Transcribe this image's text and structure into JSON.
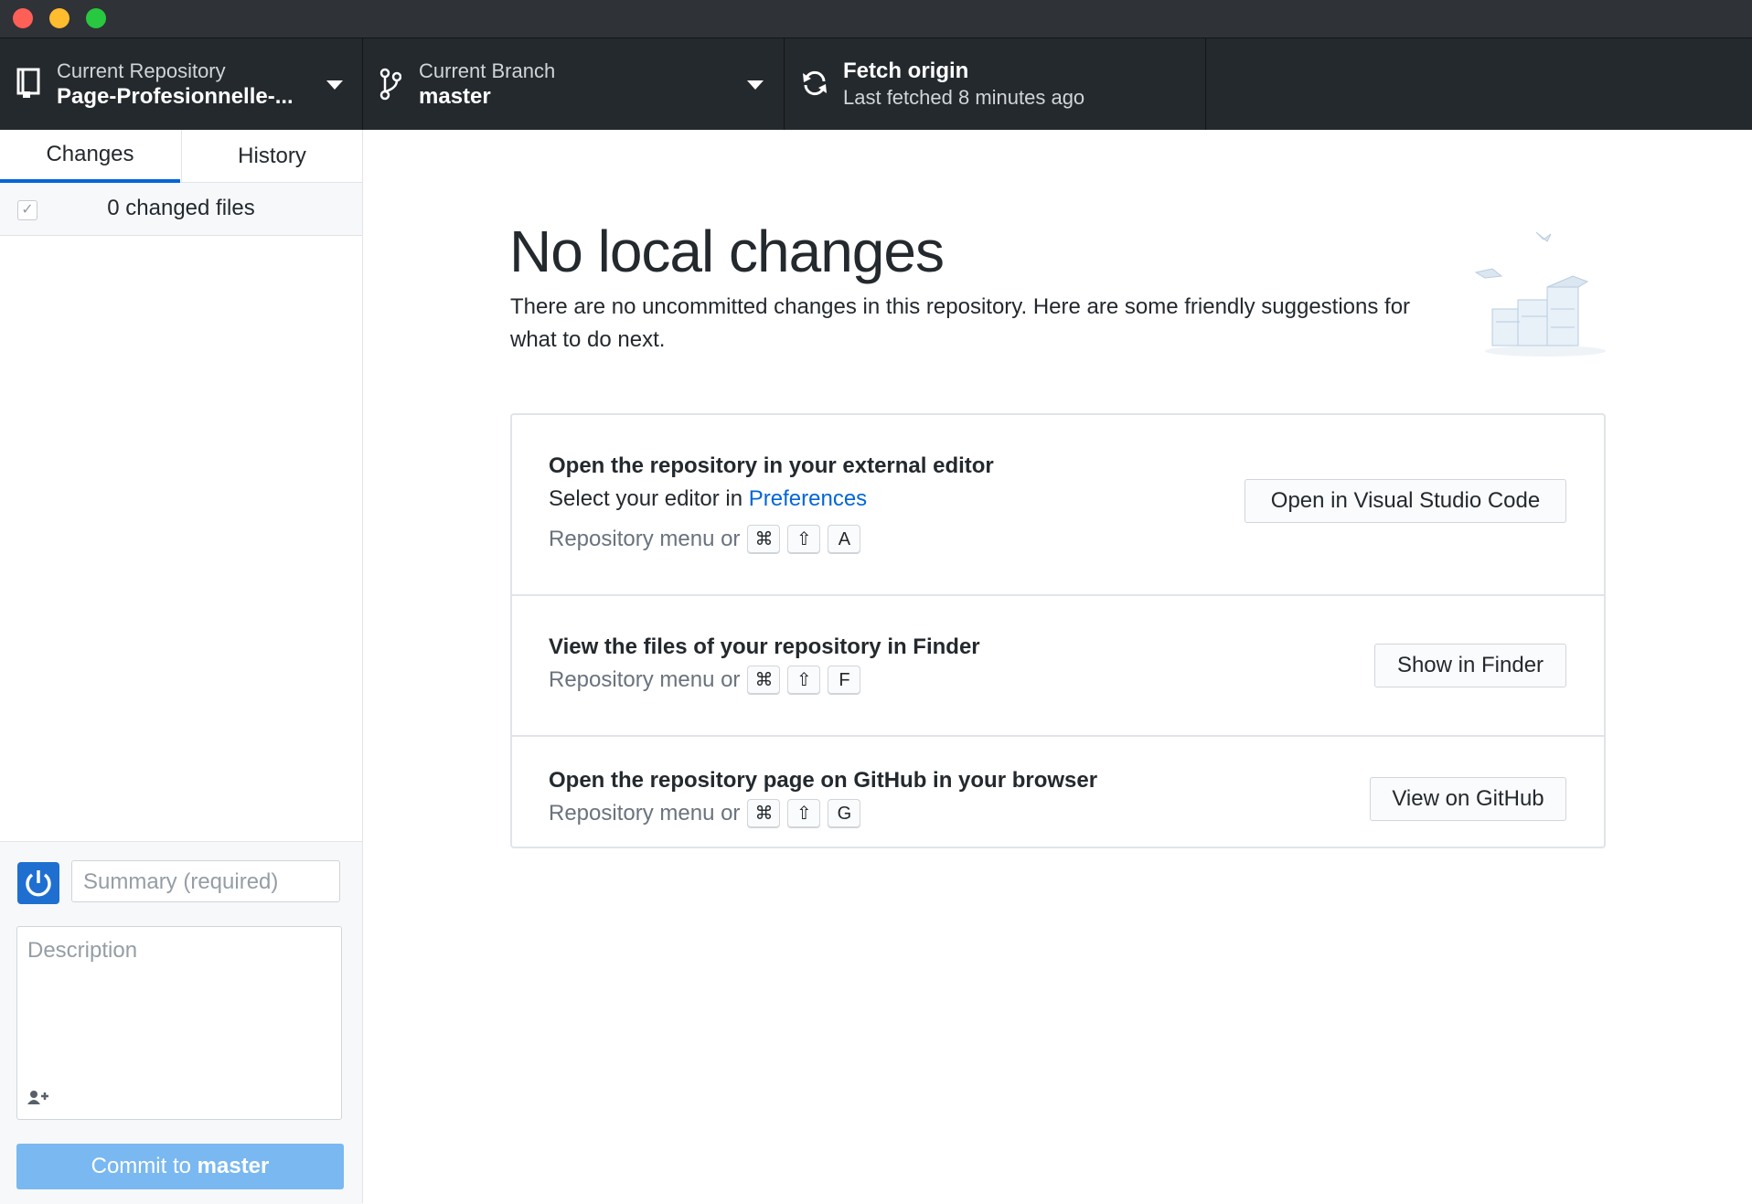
{
  "window": {
    "traffic_lights": [
      "close",
      "minimize",
      "maximize"
    ]
  },
  "toolbar": {
    "repository": {
      "label": "Current Repository",
      "value": "Page-Profesionnelle-..."
    },
    "branch": {
      "label": "Current Branch",
      "value": "master"
    },
    "fetch": {
      "title": "Fetch origin",
      "subtitle": "Last fetched 8 minutes ago"
    }
  },
  "sidebar": {
    "tabs": [
      {
        "label": "Changes",
        "active": true
      },
      {
        "label": "History",
        "active": false
      }
    ],
    "changed_files": "0 changed files",
    "commit": {
      "summary_placeholder": "Summary (required)",
      "description_placeholder": "Description",
      "button_prefix": "Commit to",
      "button_branch": "master"
    }
  },
  "main": {
    "heading": "No local changes",
    "intro": "There are no uncommitted changes in this repository. Here are some friendly suggestions for what to do next.",
    "suggestions": [
      {
        "title": "Open the repository in your external editor",
        "subtitle_prefix": "Select your editor in",
        "subtitle_link": "Preferences",
        "shortcut_prefix": "Repository menu or",
        "keys": [
          "⌘",
          "⇧",
          "A"
        ],
        "button": "Open in Visual Studio Code"
      },
      {
        "title": "View the files of your repository in Finder",
        "shortcut_prefix": "Repository menu or",
        "keys": [
          "⌘",
          "⇧",
          "F"
        ],
        "button": "Show in Finder"
      },
      {
        "title": "Open the repository page on GitHub in your browser",
        "shortcut_prefix": "Repository menu or",
        "keys": [
          "⌘",
          "⇧",
          "G"
        ],
        "button": "View on GitHub"
      }
    ]
  },
  "colors": {
    "toolbar_bg": "#24292e",
    "accent": "#0366d6",
    "commit_button": "#79b8f0",
    "avatar": "#1f6fd0"
  }
}
